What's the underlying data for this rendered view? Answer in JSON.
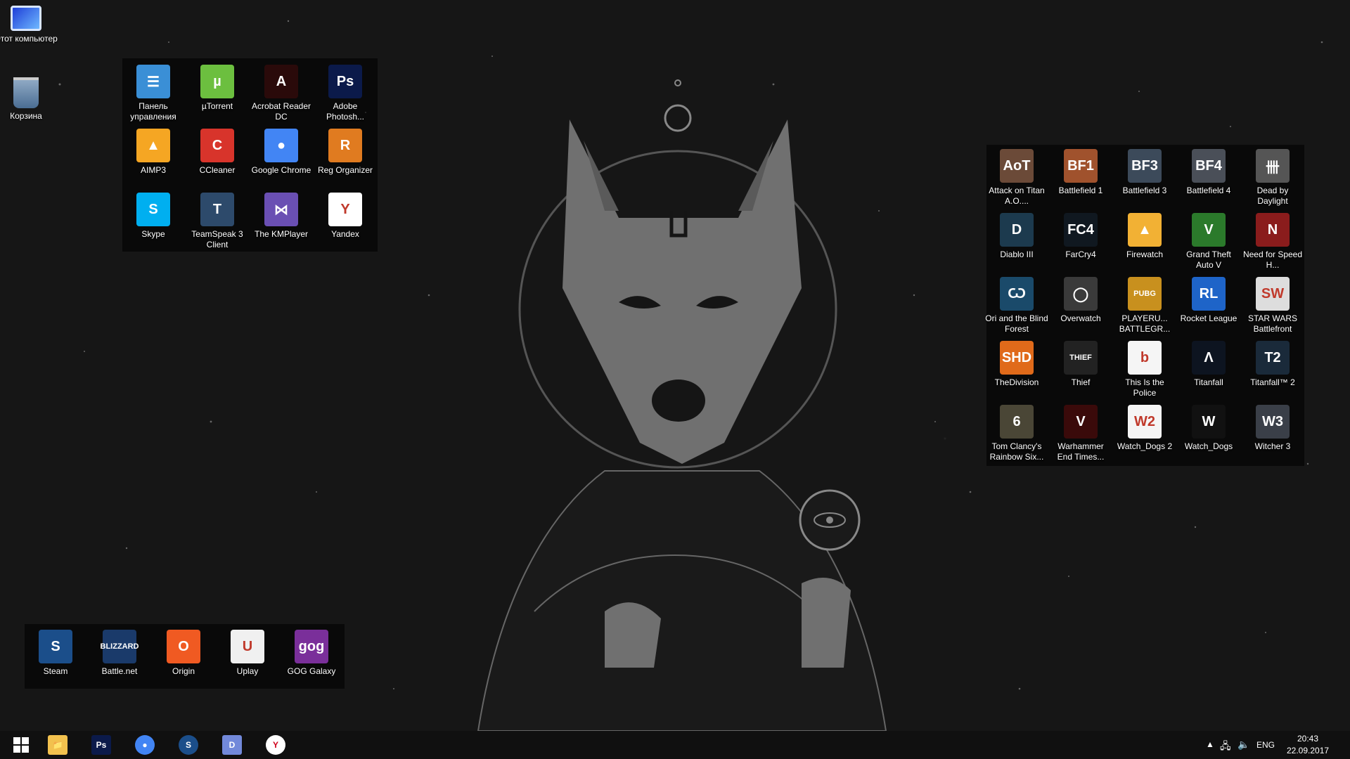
{
  "desktop_icons": [
    {
      "label": "Этот компьютер",
      "icon": "computer-icon"
    },
    {
      "label": "Корзина",
      "icon": "recycle-bin-icon"
    }
  ],
  "fence_apps": [
    {
      "label": "Панель управления",
      "icon": "control-panel-icon",
      "color": "#3a8fd6",
      "glyph": "☰"
    },
    {
      "label": "µTorrent",
      "icon": "utorrent-icon",
      "color": "#6cbf3f",
      "glyph": "µ"
    },
    {
      "label": "Acrobat Reader DC",
      "icon": "acrobat-icon",
      "color": "#2a0a0a",
      "glyph": "A"
    },
    {
      "label": "Adobe Photosh...",
      "icon": "photoshop-icon",
      "color": "#0b1a4a",
      "glyph": "Ps"
    },
    {
      "label": "AIMP3",
      "icon": "aimp-icon",
      "color": "#f5a623",
      "glyph": "▲"
    },
    {
      "label": "CCleaner",
      "icon": "ccleaner-icon",
      "color": "#d8342b",
      "glyph": "C"
    },
    {
      "label": "Google Chrome",
      "icon": "chrome-icon",
      "color": "#4285f4",
      "glyph": "●"
    },
    {
      "label": "Reg Organizer",
      "icon": "reg-organizer-icon",
      "color": "#e07b20",
      "glyph": "R"
    },
    {
      "label": "Skype",
      "icon": "skype-icon",
      "color": "#00aff0",
      "glyph": "S"
    },
    {
      "label": "TeamSpeak 3 Client",
      "icon": "teamspeak-icon",
      "color": "#2d4a6b",
      "glyph": "T"
    },
    {
      "label": "The KMPlayer",
      "icon": "kmplayer-icon",
      "color": "#6a4fb3",
      "glyph": "⋈"
    },
    {
      "label": "Yandex",
      "icon": "yandex-browser-icon",
      "color": "#ffffff",
      "glyph": "Y"
    }
  ],
  "fence_games": [
    {
      "label": "Attack on Titan  A.O....",
      "icon": "attack-on-titan-icon",
      "color": "#6b4a38",
      "glyph": "AoT"
    },
    {
      "label": "Battlefield 1",
      "icon": "battlefield1-icon",
      "color": "#a0522d",
      "glyph": "BF1"
    },
    {
      "label": "Battlefield 3",
      "icon": "battlefield3-icon",
      "color": "#3c4a5a",
      "glyph": "BF3"
    },
    {
      "label": "Battlefield 4",
      "icon": "battlefield4-icon",
      "color": "#4a4f58",
      "glyph": "BF4"
    },
    {
      "label": "Dead by Daylight",
      "icon": "dead-by-daylight-icon",
      "color": "#555555",
      "glyph": "卌"
    },
    {
      "label": "Diablo III",
      "icon": "diablo3-icon",
      "color": "#1c3a4e",
      "glyph": "D"
    },
    {
      "label": "FarCry4",
      "icon": "farcry4-icon",
      "color": "#101820",
      "glyph": "FC4"
    },
    {
      "label": "Firewatch",
      "icon": "firewatch-icon",
      "color": "#f2b134",
      "glyph": "▲"
    },
    {
      "label": "Grand Theft Auto V",
      "icon": "gta5-icon",
      "color": "#2b7a2b",
      "glyph": "V"
    },
    {
      "label": "Need for Speed H...",
      "icon": "nfs-icon",
      "color": "#8a1c1c",
      "glyph": "N"
    },
    {
      "label": "Ori and the Blind Forest",
      "icon": "ori-icon",
      "color": "#1a4a6a",
      "glyph": "Ѡ"
    },
    {
      "label": "Overwatch",
      "icon": "overwatch-icon",
      "color": "#3a3a3a",
      "glyph": "◯"
    },
    {
      "label": "PLAYERU... BATTLEGR...",
      "icon": "pubg-icon",
      "color": "#c8901e",
      "glyph": "PUBG"
    },
    {
      "label": "Rocket League",
      "icon": "rocket-league-icon",
      "color": "#1e64c8",
      "glyph": "RL"
    },
    {
      "label": "STAR WARS Battlefront",
      "icon": "battlefront-icon",
      "color": "#dddddd",
      "glyph": "SW"
    },
    {
      "label": "TheDivision",
      "icon": "division-icon",
      "color": "#e06a1a",
      "glyph": "SHD"
    },
    {
      "label": "Thief",
      "icon": "thief-icon",
      "color": "#222222",
      "glyph": "THIEF"
    },
    {
      "label": "This Is the Police",
      "icon": "this-is-the-police-icon",
      "color": "#f5f5f5",
      "glyph": "b"
    },
    {
      "label": "Titanfall",
      "icon": "titanfall-icon",
      "color": "#0d1420",
      "glyph": "Λ"
    },
    {
      "label": "Titanfall™ 2",
      "icon": "titanfall2-icon",
      "color": "#1a2a3a",
      "glyph": "T2"
    },
    {
      "label": "Tom Clancy's Rainbow Six...",
      "icon": "rainbow-six-icon",
      "color": "#4a4636",
      "glyph": "6"
    },
    {
      "label": "Warhammer End Times...",
      "icon": "warhammer-icon",
      "color": "#3a0a0a",
      "glyph": "V"
    },
    {
      "label": "Watch_Dogs 2",
      "icon": "watch-dogs2-icon",
      "color": "#f5f5f5",
      "glyph": "W2"
    },
    {
      "label": "Watch_Dogs",
      "icon": "watch-dogs-icon",
      "color": "#111111",
      "glyph": "W"
    },
    {
      "label": "Witcher 3",
      "icon": "witcher3-icon",
      "color": "#3a3f48",
      "glyph": "W3"
    }
  ],
  "fence_launchers": [
    {
      "label": "Steam",
      "icon": "steam-icon",
      "color": "#1b4e8a",
      "glyph": "S"
    },
    {
      "label": "Battle.net",
      "icon": "battlenet-icon",
      "color": "#1a3a6a",
      "glyph": "BLIZZARD"
    },
    {
      "label": "Origin",
      "icon": "origin-icon",
      "color": "#f05a22",
      "glyph": "O"
    },
    {
      "label": "Uplay",
      "icon": "uplay-icon",
      "color": "#f0f0f0",
      "glyph": "U"
    },
    {
      "label": "GOG Galaxy",
      "icon": "gog-galaxy-icon",
      "color": "#7a2f9a",
      "glyph": "gog"
    }
  ],
  "taskbar": {
    "start": {
      "icon": "windows-start-icon"
    },
    "pinned": [
      {
        "name": "file-explorer",
        "icon": "folder-icon",
        "color": "#f2c14e",
        "glyph": "📁"
      },
      {
        "name": "photoshop",
        "icon": "photoshop-icon",
        "color": "#0b1a4a",
        "glyph": "Ps"
      },
      {
        "name": "chrome",
        "icon": "chrome-icon",
        "color": "#4285f4",
        "glyph": "●"
      },
      {
        "name": "steam",
        "icon": "steam-icon",
        "color": "#1b4e8a",
        "glyph": "S"
      },
      {
        "name": "discord",
        "icon": "discord-icon",
        "color": "#7289da",
        "glyph": "D"
      },
      {
        "name": "yandex",
        "icon": "yandex-browser-icon",
        "color": "#ffffff",
        "glyph": "Y"
      }
    ],
    "tray": {
      "language": "ENG",
      "time": "20:43",
      "date": "22.09.2017"
    }
  }
}
